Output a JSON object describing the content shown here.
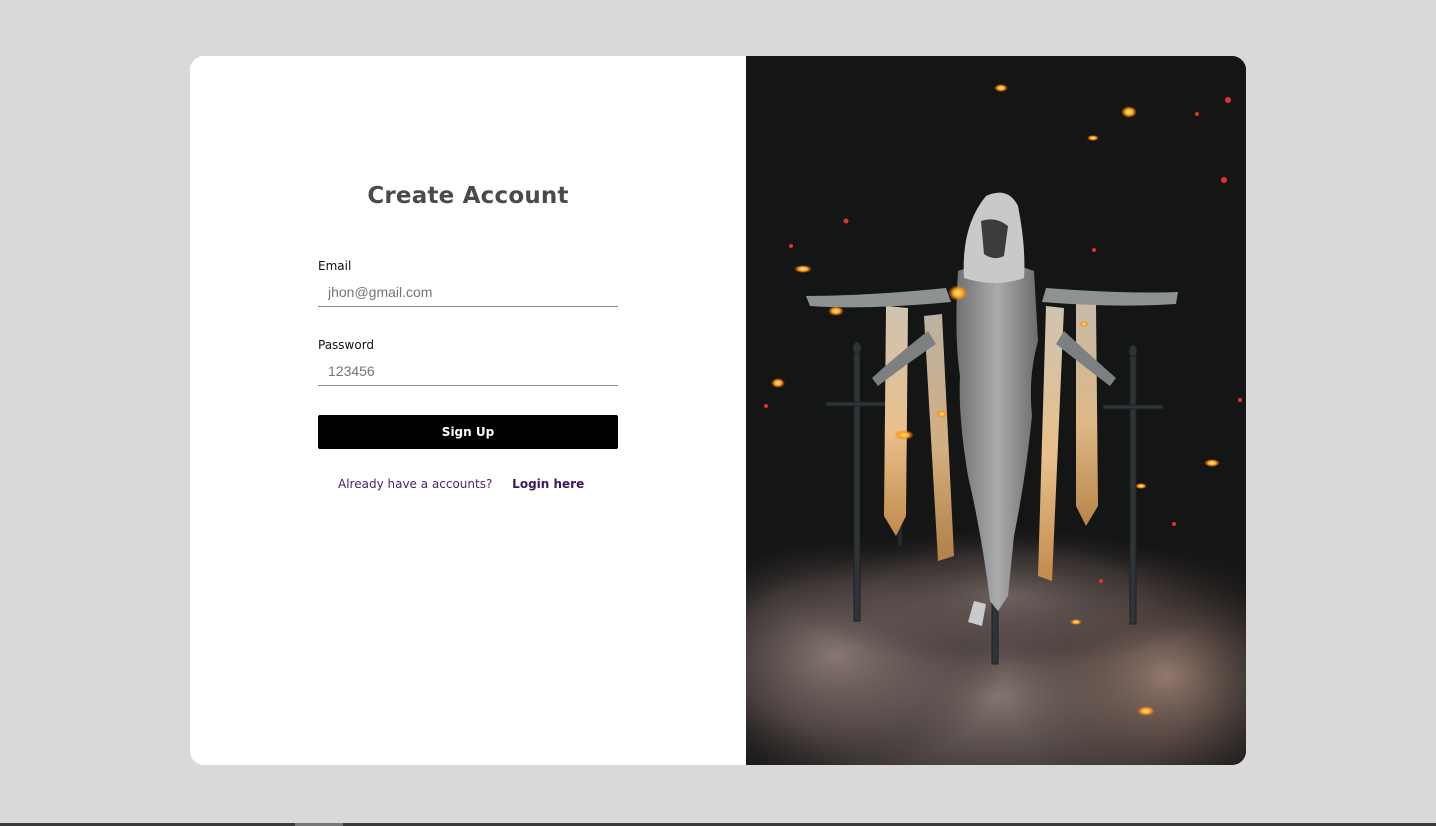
{
  "form": {
    "title": "Create Account",
    "email": {
      "label": "Email",
      "placeholder": "jhon@gmail.com",
      "value": ""
    },
    "password": {
      "label": "Password",
      "placeholder": "123456",
      "value": ""
    },
    "submit_label": "Sign Up",
    "login_prompt": "Already have a accounts?",
    "login_link": "Login here"
  },
  "hero": {
    "icon": "hooded-figure-with-swords-illustration"
  },
  "colors": {
    "page_background": "#d9d9d9",
    "card_background": "#ffffff",
    "button_background": "#000000",
    "link_color": "#3d1560",
    "hero_background": "#141414"
  }
}
